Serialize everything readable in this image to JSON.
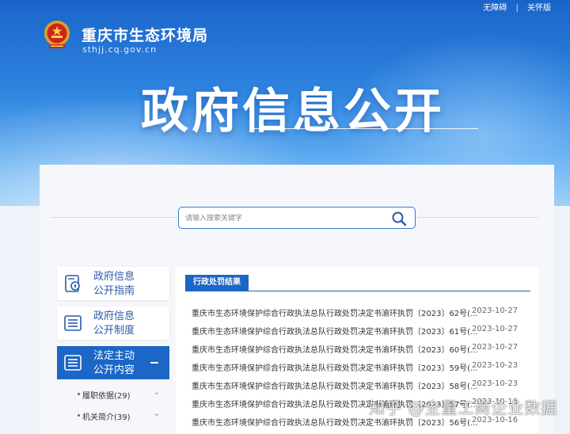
{
  "topbar": {
    "accessible": "无障碍",
    "separator": "|",
    "elderly": "关怀版"
  },
  "header": {
    "site_name": "重庆市生态环境局",
    "site_url": "sthjj.cq.gov.cn",
    "emblem_icon": "national-emblem-icon"
  },
  "hero": {
    "title": "政府信息公开"
  },
  "search": {
    "placeholder": "请输入搜索关键字",
    "value": "",
    "icon": "search-icon"
  },
  "sidebar": {
    "items": [
      {
        "label_line1": "政府信息",
        "label_line2": "公开指南",
        "icon": "compass-doc-icon",
        "active": false
      },
      {
        "label_line1": "政府信息",
        "label_line2": "公开制度",
        "icon": "list-doc-icon",
        "active": false
      },
      {
        "label_line1": "法定主动",
        "label_line2": "公开内容",
        "icon": "list-doc-icon",
        "active": true
      }
    ],
    "subitems": [
      {
        "label": "履职依据(29)",
        "chevron": "⌄"
      },
      {
        "label": "机关简介(39)",
        "chevron": "⌄"
      }
    ]
  },
  "content": {
    "tab_label": "行政处罚结果",
    "rows": [
      {
        "title": "重庆市生态环境保护综合行政执法总队行政处罚决定书渝环执罚〔2023〕62号(...",
        "date": "2023-10-27"
      },
      {
        "title": "重庆市生态环境保护综合行政执法总队行政处罚决定书渝环执罚〔2023〕61号(...",
        "date": "2023-10-27"
      },
      {
        "title": "重庆市生态环境保护综合行政执法总队行政处罚决定书渝环执罚〔2023〕60号(...",
        "date": "2023-10-27"
      },
      {
        "title": "重庆市生态环境保护综合行政执法总队行政处罚决定书渝环执罚〔2023〕59号(...",
        "date": "2023-10-23"
      },
      {
        "title": "重庆市生态环境保护综合行政执法总队行政处罚决定书渝环执罚〔2023〕58号(...",
        "date": "2023-10-23"
      },
      {
        "title": "重庆市生态环境保护综合行政执法总队行政处罚决定书渝环执罚〔2023〕57号(...",
        "date": "2023-10-16"
      },
      {
        "title": "重庆市生态环境保护综合行政执法总队行政处罚决定书渝环执罚〔2023〕56号(...",
        "date": "2023-10-16"
      }
    ]
  },
  "watermark": {
    "text": "知乎 @全量工商企业数据"
  },
  "colors": {
    "primary": "#1c66c6",
    "hero_top": "#1a64c9",
    "hero_bottom": "#9fd0f7",
    "link_text": "#2a5aa8"
  }
}
